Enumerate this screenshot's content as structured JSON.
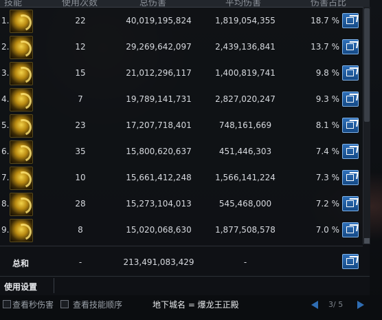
{
  "header": {
    "col_skill": "技能",
    "col_count": "使用次数",
    "col_total": "总伤害",
    "col_avg": "平均伤害",
    "col_pct": "伤害占比"
  },
  "rows": [
    {
      "index": "1.",
      "icon": "skill-icon",
      "count": "22",
      "total": "40,019,195,824",
      "avg": "1,819,054,355",
      "pct": "18.7 %"
    },
    {
      "index": "2.",
      "icon": "skill-icon",
      "count": "12",
      "total": "29,269,642,097",
      "avg": "2,439,136,841",
      "pct": "13.7 %"
    },
    {
      "index": "3.",
      "icon": "skill-icon",
      "count": "15",
      "total": "21,012,296,117",
      "avg": "1,400,819,741",
      "pct": "9.8 %"
    },
    {
      "index": "4.",
      "icon": "skill-icon",
      "count": "7",
      "total": "19,789,141,731",
      "avg": "2,827,020,247",
      "pct": "9.3 %"
    },
    {
      "index": "5.",
      "icon": "skill-icon",
      "count": "23",
      "total": "17,207,718,401",
      "avg": "748,161,669",
      "pct": "8.1 %"
    },
    {
      "index": "6.",
      "icon": "skill-icon",
      "count": "35",
      "total": "15,800,620,637",
      "avg": "451,446,303",
      "pct": "7.4 %"
    },
    {
      "index": "7.",
      "icon": "skill-icon",
      "count": "10",
      "total": "15,661,412,248",
      "avg": "1,566,141,224",
      "pct": "7.3 %"
    },
    {
      "index": "8.",
      "icon": "skill-icon",
      "count": "28",
      "total": "15,273,104,013",
      "avg": "545,468,000",
      "pct": "7.2 %"
    },
    {
      "index": "9.",
      "icon": "skill-icon",
      "count": "8",
      "total": "15,020,068,630",
      "avg": "1,877,508,578",
      "pct": "7.0 %"
    }
  ],
  "total": {
    "label": "总和",
    "count": "-",
    "total": "213,491,083,429",
    "avg": "-"
  },
  "settings_label": "使用设置",
  "bottom": {
    "check_sec_damage": "查看秒伤害",
    "check_skill_order": "查看技能顺序",
    "dungeon": "地下城名 = 爆龙王正殿",
    "page": "3/ 5"
  },
  "colors": {
    "export_button": "#2e6fb8",
    "skill_icon": "#f2d24a",
    "page_arrows": "#2f6db3"
  }
}
